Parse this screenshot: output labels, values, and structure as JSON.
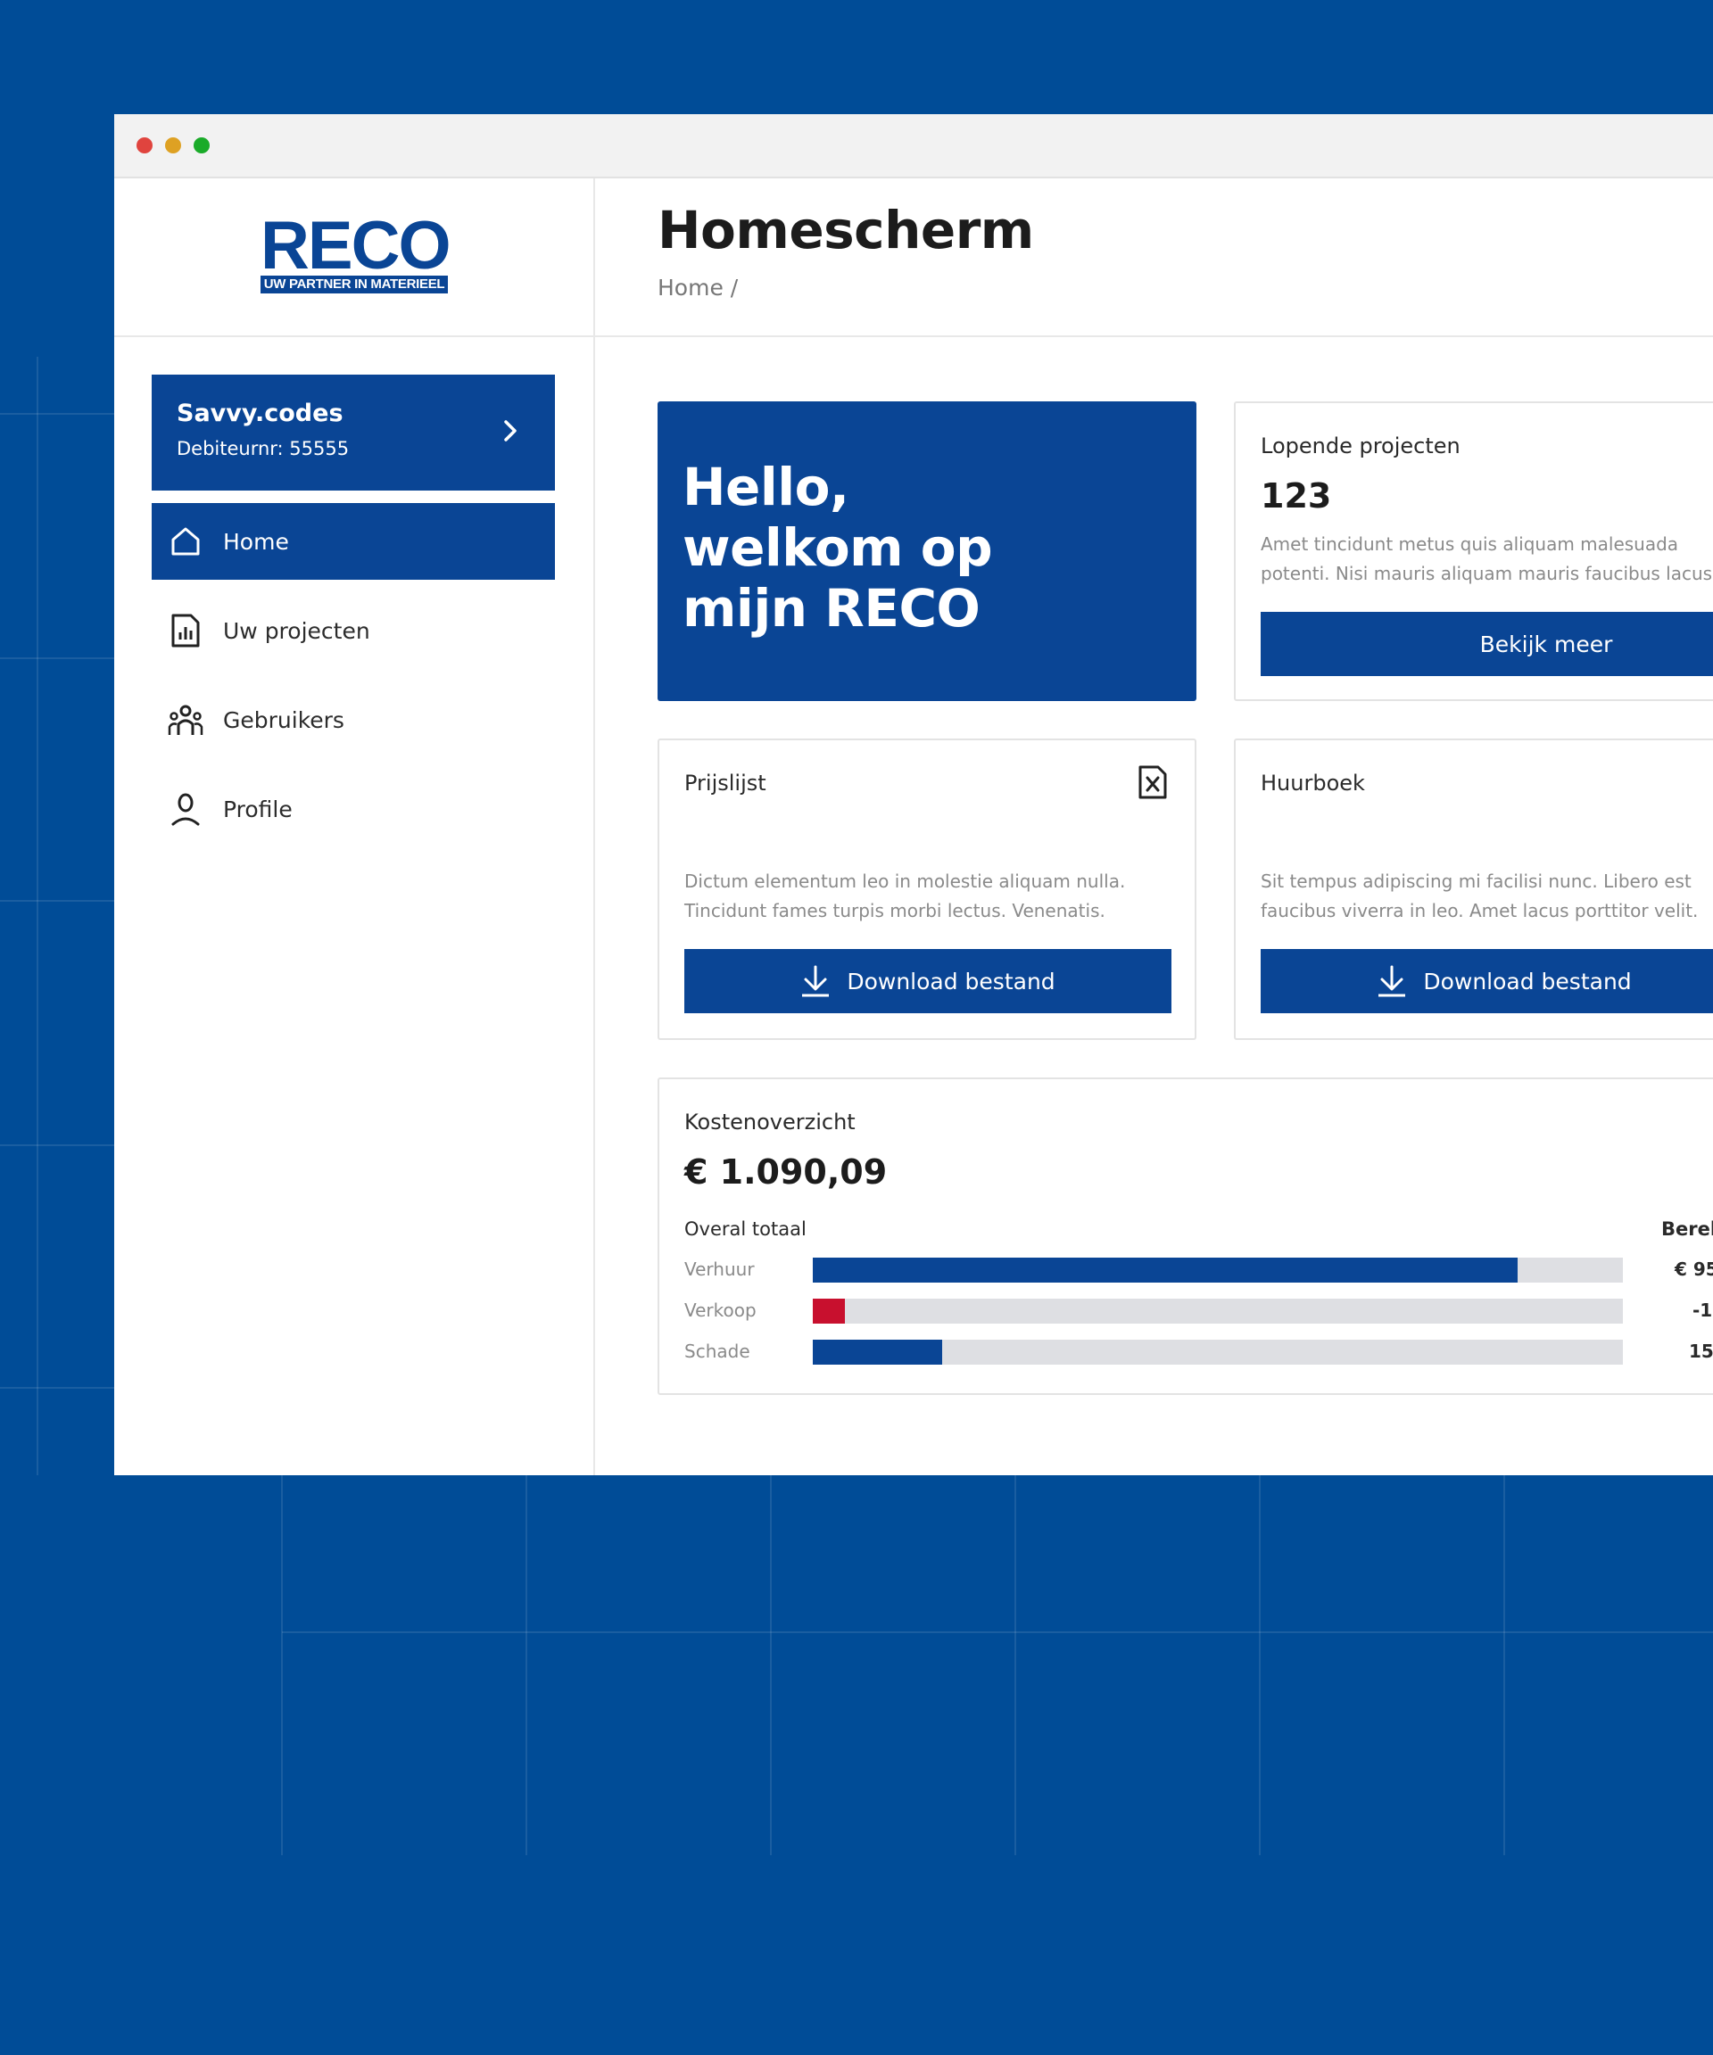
{
  "window": {
    "dots": [
      "close",
      "minimize",
      "maximize"
    ]
  },
  "brand": {
    "name": "RECO",
    "tagline": "UW PARTNER IN MATERIEEL",
    "color": "#0a4595"
  },
  "account": {
    "name": "Savvy.codes",
    "debtor": "Debiteurnr: 55555"
  },
  "nav": [
    {
      "label": "Home",
      "icon": "home-icon",
      "active": true
    },
    {
      "label": "Uw projecten",
      "icon": "report-icon",
      "active": false
    },
    {
      "label": "Gebruikers",
      "icon": "users-icon",
      "active": false
    },
    {
      "label": "Profile",
      "icon": "user-icon",
      "active": false
    }
  ],
  "header": {
    "title": "Homescherm",
    "breadcrumb": "Home /"
  },
  "hero": {
    "lines": [
      "Hello,",
      "welkom op",
      "mijn RECO"
    ]
  },
  "projects": {
    "title": "Lopende projecten",
    "count": "123",
    "text_lines": [
      "Amet tincidunt metus quis aliquam malesuada",
      "potenti. Nisi mauris aliquam mauris faucibus lacus"
    ],
    "button": "Bekijk meer"
  },
  "pricelist": {
    "title": "Prijslijst",
    "icon": "excel-file-icon",
    "text_lines": [
      "Dictum elementum leo in molestie aliquam nulla.",
      "Tincidunt fames turpis morbi lectus. Venenatis."
    ],
    "button": "Download bestand"
  },
  "rentbook": {
    "title": "Huurboek",
    "text_lines": [
      "Sit tempus adipiscing mi facilisi nunc. Libero est",
      "faucibus viverra in leo. Amet lacus porttitor velit."
    ],
    "button": "Download bestand"
  },
  "costs": {
    "title": "Kostenoverzicht",
    "total": "€ 1.090,09",
    "overall_label": "Overal totaal",
    "calc_label": "Berek",
    "rows": [
      {
        "label": "Verhuur",
        "fraction": 0.87,
        "color": "#0a4595",
        "value": "€ 95"
      },
      {
        "label": "Verkoop",
        "fraction": 0.04,
        "color": "#c8102e",
        "value": "-1"
      },
      {
        "label": "Schade",
        "fraction": 0.16,
        "color": "#0a4595",
        "value": "15"
      }
    ]
  },
  "colors": {
    "background": "#004c97",
    "accent": "#0a4595",
    "danger": "#c8102e"
  }
}
